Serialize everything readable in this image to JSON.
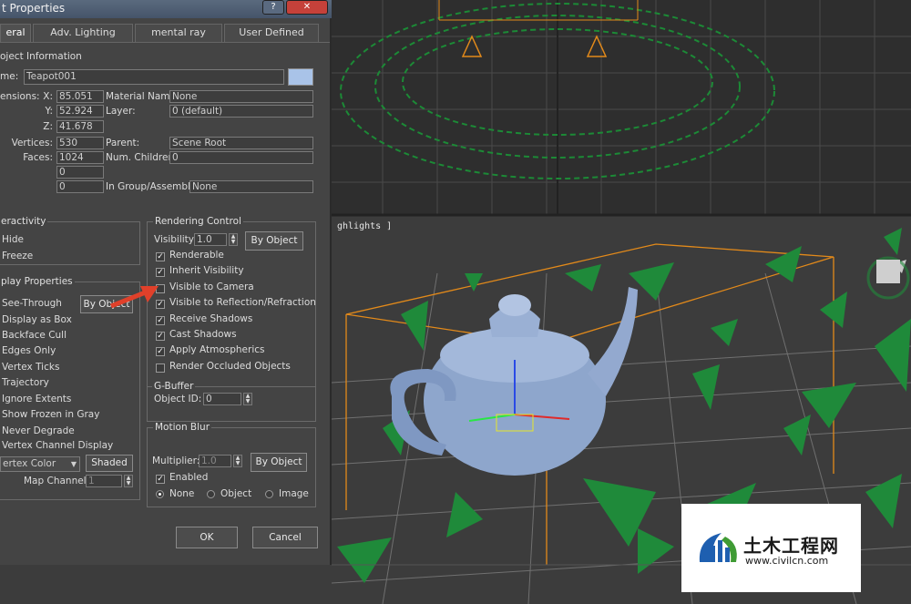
{
  "window": {
    "title": "t Properties",
    "help_glyph": "?",
    "close_glyph": "✕"
  },
  "tabs": [
    "eral",
    "Adv. Lighting",
    "mental ray",
    "User Defined"
  ],
  "object_info": {
    "group_title": "oject Information",
    "name_label": "me:",
    "name_value": "Teapot001",
    "dimensions_label": "ensions:",
    "x_label": "X:",
    "x_value": "85.051",
    "y_label": "Y:",
    "y_value": "52.924",
    "z_label": "Z:",
    "z_value": "41.678",
    "vertices_label": "Vertices:",
    "vertices_value": "530",
    "faces_label": "Faces:",
    "faces_value": "1024",
    "blank1": "0",
    "blank2": "0",
    "material_label": "Material Name:",
    "material_value": "None",
    "layer_label": "Layer:",
    "layer_value": "0 (default)",
    "parent_label": "Parent:",
    "parent_value": "Scene Root",
    "children_label": "Num. Children:",
    "children_value": "0",
    "group_label": "In Group/Assembly:",
    "group_value": "None"
  },
  "interactivity": {
    "title": "eractivity",
    "hide": "Hide",
    "freeze": "Freeze"
  },
  "display": {
    "title": "play Properties",
    "by_object": "By Object",
    "items": [
      "See-Through",
      "Display as Box",
      "Backface Cull",
      "Edges Only",
      "Vertex Ticks",
      "Trajectory",
      "Ignore Extents",
      "Show Frozen in Gray",
      "Never Degrade",
      "Vertex Channel Display"
    ],
    "vertex_color": "ertex Color",
    "shaded": "Shaded",
    "map_channel_label": "Map Channel:",
    "map_channel_value": "1"
  },
  "rendering": {
    "title": "Rendering Control",
    "visibility_label": "Visibility:",
    "visibility_value": "1.0",
    "by_object": "By Object",
    "items": [
      {
        "label": "Renderable",
        "checked": true
      },
      {
        "label": "Inherit Visibility",
        "checked": true
      },
      {
        "label": "Visible to Camera",
        "checked": false
      },
      {
        "label": "Visible to Reflection/Refraction",
        "checked": true
      },
      {
        "label": "Receive Shadows",
        "checked": true
      },
      {
        "label": "Cast Shadows",
        "checked": true
      },
      {
        "label": "Apply Atmospherics",
        "checked": true
      },
      {
        "label": "Render Occluded Objects",
        "checked": false
      }
    ]
  },
  "gbuffer": {
    "title": "G-Buffer",
    "object_id_label": "Object ID:",
    "object_id_value": "0"
  },
  "motion_blur": {
    "title": "Motion Blur",
    "multiplier_label": "Multiplier:",
    "multiplier_value": "1.0",
    "by_object": "By Object",
    "enabled": "Enabled",
    "none": "None",
    "object": "Object",
    "image": "Image"
  },
  "buttons": {
    "ok": "OK",
    "cancel": "Cancel"
  },
  "viewport": {
    "label": "ghlights ]"
  },
  "watermark": {
    "title": "土木工程网",
    "url": "www.civilcn.com"
  },
  "colors": {
    "grid": "#6a6a6a",
    "foliage": "#1f8a3a",
    "teapot": "#8ea6cc",
    "accent": "#e38a1a",
    "arrow": "#e0402a",
    "swatch": "#a9c3e8"
  }
}
